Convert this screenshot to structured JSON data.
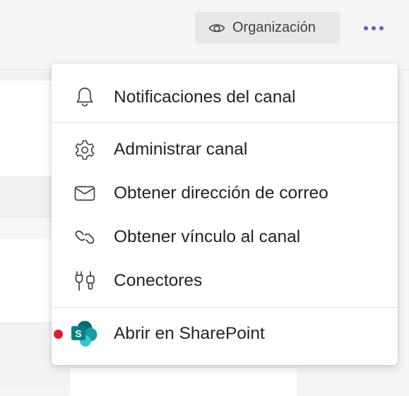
{
  "header": {
    "visibility_label": "Organización",
    "visibility_icon": "eye-icon",
    "more_icon": "more-options-icon"
  },
  "menu": {
    "items": [
      {
        "label": "Notificaciones del canal",
        "icon": "bell-icon"
      },
      {
        "label": "Administrar canal",
        "icon": "gear-icon"
      },
      {
        "label": "Obtener dirección de correo",
        "icon": "mail-icon"
      },
      {
        "label": "Obtener vínculo al canal",
        "icon": "link-icon"
      },
      {
        "label": "Conectores",
        "icon": "connectors-icon"
      },
      {
        "label": "Abrir en SharePoint",
        "icon": "sharepoint-icon",
        "has_unread_dot": true
      }
    ]
  },
  "colors": {
    "accent": "#5b5fc7",
    "sharepoint_primary": "#038387",
    "sharepoint_light": "#37c6d0",
    "notification_dot": "#d71f2f"
  }
}
